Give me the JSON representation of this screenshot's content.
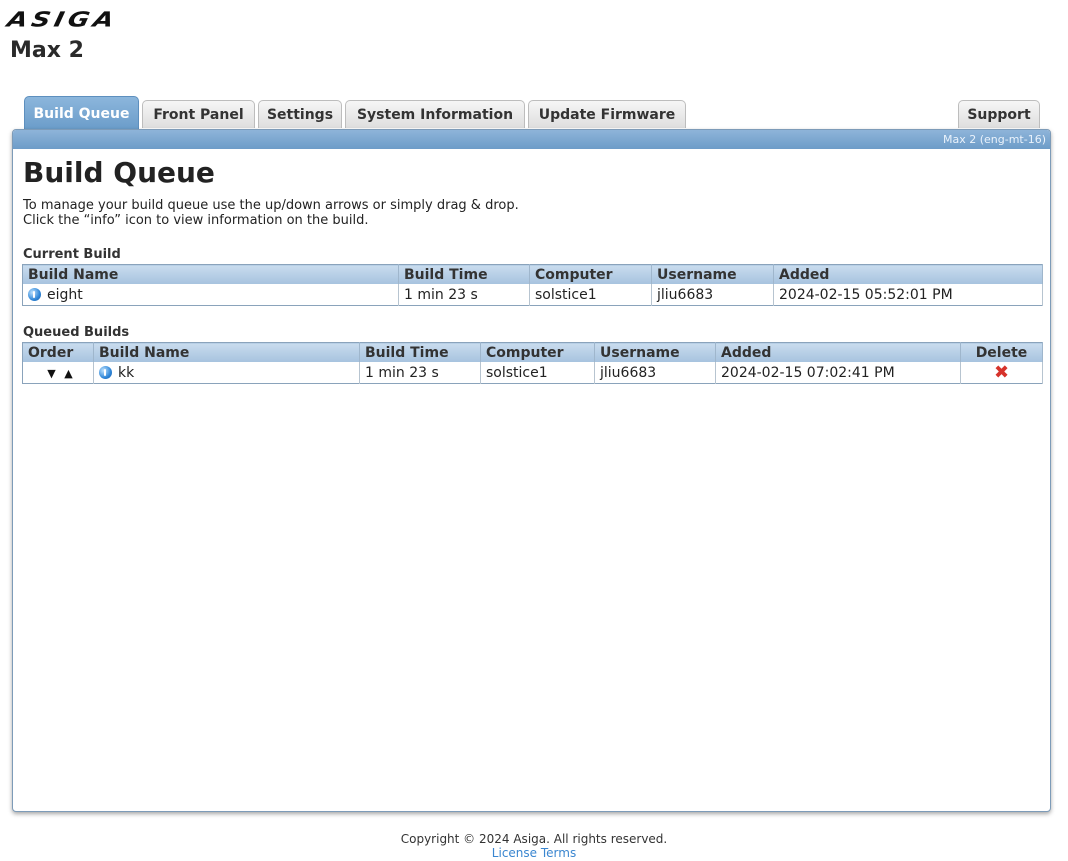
{
  "brand": {
    "logo_text": "ASIGA",
    "printer_name": "Max 2"
  },
  "tabs": [
    {
      "label": "Build Queue",
      "active": true
    },
    {
      "label": "Front Panel",
      "active": false
    },
    {
      "label": "Settings",
      "active": false
    },
    {
      "label": "System Information",
      "active": false
    },
    {
      "label": "Update Firmware",
      "active": false
    },
    {
      "label": "Support",
      "active": false
    }
  ],
  "panel": {
    "device_label": "Max 2 (eng-mt-16)"
  },
  "page": {
    "title": "Build Queue",
    "intro_line1": "To manage your build queue use the up/down arrows or simply drag & drop.",
    "intro_line2": "Click the “info” icon to view information on the build."
  },
  "current_build": {
    "title": "Current Build",
    "columns": [
      "Build Name",
      "Build Time",
      "Computer",
      "Username",
      "Added"
    ],
    "row": {
      "name": "eight",
      "time": "1 min 23 s",
      "computer": "solstice1",
      "username": "jliu6683",
      "added": "2024-02-15 05:52:01 PM"
    }
  },
  "queued_builds": {
    "title": "Queued Builds",
    "columns": [
      "Order",
      "Build Name",
      "Build Time",
      "Computer",
      "Username",
      "Added",
      "Delete"
    ],
    "rows": [
      {
        "down": "▼",
        "up": "▲",
        "name": "kk",
        "time": "1 min 23 s",
        "computer": "solstice1",
        "username": "jliu6683",
        "added": "2024-02-15 07:02:41 PM",
        "delete": "✖"
      }
    ]
  },
  "footer": {
    "copyright": "Copyright © 2024 Asiga. All rights reserved.",
    "license_link": "License Terms"
  },
  "colors": {
    "accent": "#6d9cc8",
    "delete": "#d6332b",
    "link": "#3a86d0"
  },
  "icons": {
    "info": "info-icon",
    "delete": "delete-x-icon",
    "up": "arrow-up-icon",
    "down": "arrow-down-icon"
  }
}
